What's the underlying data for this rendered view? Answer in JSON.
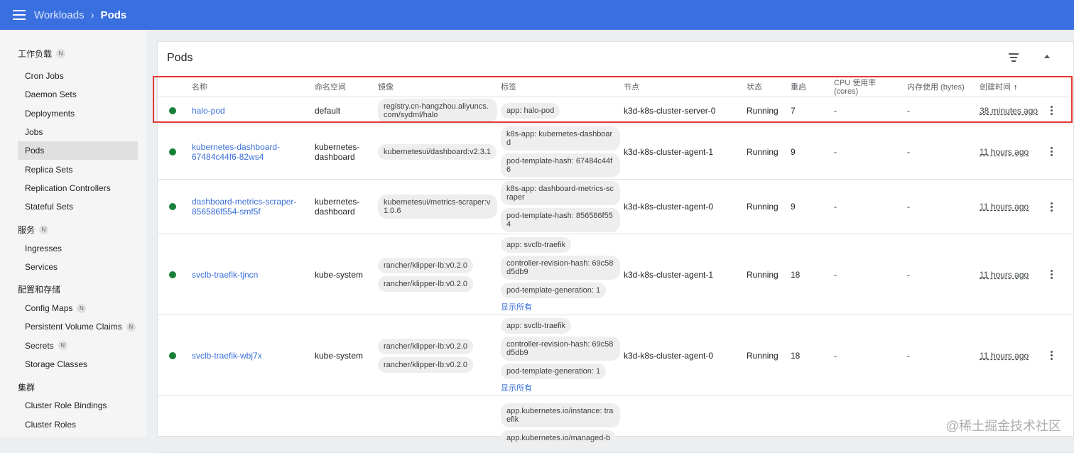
{
  "header": {
    "menu_icon": "hamburger-menu-icon",
    "crumb_parent": "Workloads",
    "crumb_sep": "›",
    "crumb_current": "Pods"
  },
  "sidebar": {
    "groups": [
      {
        "label": "工作负载",
        "badge": "N",
        "items": [
          "Cron Jobs",
          "Daemon Sets",
          "Deployments",
          "Jobs",
          "Pods",
          "Replica Sets",
          "Replication Controllers",
          "Stateful Sets"
        ]
      },
      {
        "label": "服务",
        "badge": "N",
        "items": [
          "Ingresses",
          "Services"
        ]
      },
      {
        "label": "配置和存储",
        "badge": "",
        "items": [
          "Config Maps",
          "Persistent Volume Claims",
          "Secrets",
          "Storage Classes"
        ]
      },
      {
        "label": "集群",
        "badge": "",
        "items": [
          "Cluster Role Bindings",
          "Cluster Roles"
        ]
      }
    ],
    "item_badges": {
      "Config Maps": "N",
      "Persistent Volume Claims": "N",
      "Secrets": "N"
    },
    "active": "Pods"
  },
  "card": {
    "title": "Pods",
    "columns": [
      "名称",
      "命名空间",
      "镜像",
      "标签",
      "节点",
      "状态",
      "重启",
      "CPU 使用率 (cores)",
      "内存使用 (bytes)",
      "创建时间"
    ],
    "sort_arrow": "↑",
    "rows": [
      {
        "name": "halo-pod",
        "namespace": "default",
        "images": [
          "registry.cn-hangzhou.aliyuncs.com/sydml/halo"
        ],
        "labels": [
          "app: halo-pod"
        ],
        "show_all": "",
        "node": "k3d-k8s-cluster-server-0",
        "status": "Running",
        "restarts": "7",
        "cpu": "-",
        "memory": "-",
        "age": "38 minutes ago"
      },
      {
        "name": "kubernetes-dashboard-67484c44f6-82ws4",
        "namespace": "kubernetes-dashboard",
        "images": [
          "kubernetesui/dashboard:v2.3.1"
        ],
        "labels": [
          "k8s-app: kubernetes-dashboard",
          "pod-template-hash: 67484c44f6"
        ],
        "show_all": "",
        "node": "k3d-k8s-cluster-agent-1",
        "status": "Running",
        "restarts": "9",
        "cpu": "-",
        "memory": "-",
        "age": "11 hours ago"
      },
      {
        "name": "dashboard-metrics-scraper-856586f554-smf5f",
        "namespace": "kubernetes-dashboard",
        "images": [
          "kubernetesui/metrics-scraper:v1.0.6"
        ],
        "labels": [
          "k8s-app: dashboard-metrics-scraper",
          "pod-template-hash: 856586f554"
        ],
        "show_all": "",
        "node": "k3d-k8s-cluster-agent-0",
        "status": "Running",
        "restarts": "9",
        "cpu": "-",
        "memory": "-",
        "age": "11 hours ago"
      },
      {
        "name": "svclb-traefik-tjncn",
        "namespace": "kube-system",
        "images": [
          "rancher/klipper-lb:v0.2.0",
          "rancher/klipper-lb:v0.2.0"
        ],
        "labels": [
          "app: svclb-traefik",
          "controller-revision-hash: 69c58d5db9",
          "pod-template-generation: 1"
        ],
        "show_all": "显示所有",
        "node": "k3d-k8s-cluster-agent-1",
        "status": "Running",
        "restarts": "18",
        "cpu": "-",
        "memory": "-",
        "age": "11 hours ago"
      },
      {
        "name": "svclb-traefik-wbj7x",
        "namespace": "kube-system",
        "images": [
          "rancher/klipper-lb:v0.2.0",
          "rancher/klipper-lb:v0.2.0"
        ],
        "labels": [
          "app: svclb-traefik",
          "controller-revision-hash: 69c58d5db9",
          "pod-template-generation: 1"
        ],
        "show_all": "显示所有",
        "node": "k3d-k8s-cluster-agent-0",
        "status": "Running",
        "restarts": "18",
        "cpu": "-",
        "memory": "-",
        "age": "11 hours ago"
      },
      {
        "name": "",
        "namespace": "",
        "images": [],
        "labels": [
          "app.kubernetes.io/instance: traefik",
          "app.kubernetes.io/managed-b"
        ],
        "show_all": "",
        "node": "",
        "status": "",
        "restarts": "",
        "cpu": "",
        "memory": "",
        "age": ""
      }
    ]
  },
  "watermark": "@稀土掘金技术社区",
  "colors": {
    "topbar": "#3a6fe0",
    "link": "#3b6fd8",
    "status_ok": "#188038",
    "highlight": "#e53935"
  }
}
